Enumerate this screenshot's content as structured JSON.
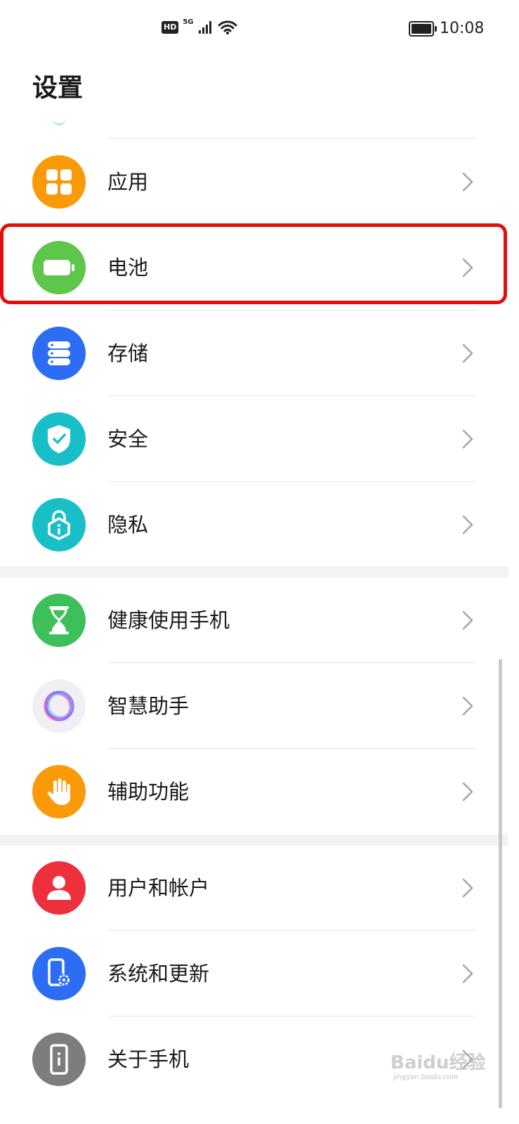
{
  "status_bar": {
    "hd": "HD",
    "network": "5G",
    "time": "10:08"
  },
  "page_title": "设置",
  "groups": [
    {
      "items": [
        {
          "label": "应用",
          "icon": "apps-grid-icon",
          "color": "#fa9a08"
        },
        {
          "label": "电池",
          "icon": "battery-icon",
          "color": "#5ec64a"
        },
        {
          "label": "存储",
          "icon": "storage-icon",
          "color": "#2c6df3"
        },
        {
          "label": "安全",
          "icon": "shield-check-icon",
          "color": "#19bfc7"
        },
        {
          "label": "隐私",
          "icon": "privacy-lock-icon",
          "color": "#19bfc7"
        }
      ]
    },
    {
      "items": [
        {
          "label": "健康使用手机",
          "icon": "hourglass-icon",
          "color": "#3dc05a"
        },
        {
          "label": "智慧助手",
          "icon": "assistant-ring-icon",
          "color": "#f1eef6"
        },
        {
          "label": "辅助功能",
          "icon": "hand-icon",
          "color": "#fa9a08"
        }
      ]
    },
    {
      "items": [
        {
          "label": "用户和帐户",
          "icon": "user-icon",
          "color": "#ee2f3c"
        },
        {
          "label": "系统和更新",
          "icon": "phone-gear-icon",
          "color": "#2c6df3"
        },
        {
          "label": "关于手机",
          "icon": "phone-info-icon",
          "color": "#7d7d7d"
        }
      ]
    }
  ],
  "watermark": {
    "text": "Baidu经验",
    "sub": "jingyan.baidu.com"
  },
  "highlight_color": "#e40d0d"
}
